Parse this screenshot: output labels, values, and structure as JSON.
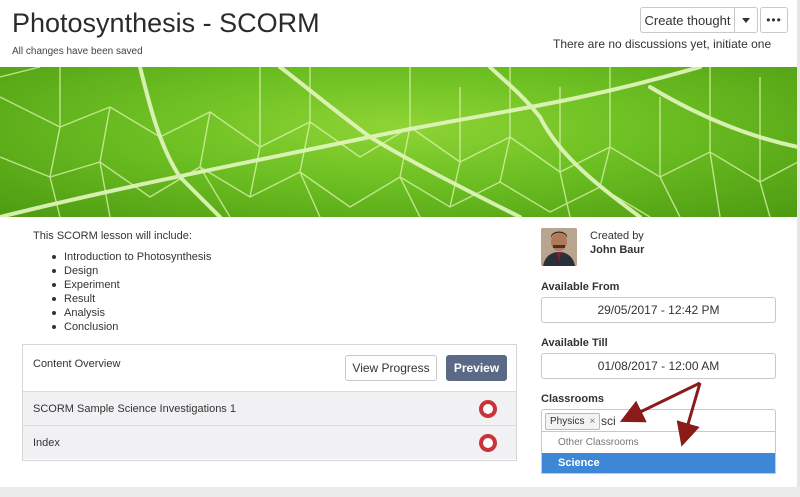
{
  "header": {
    "title": "Photosynthesis - SCORM",
    "save_status": "All changes have been saved",
    "create_thought_label": "Create thought",
    "more_label": "•••",
    "discussion_note": "There are no discussions yet, initiate one"
  },
  "lesson": {
    "intro": "This SCORM lesson will include:",
    "topics": [
      "Introduction to Photosynthesis",
      "Design",
      "Experiment",
      "Result",
      "Analysis",
      "Conclusion"
    ]
  },
  "content_overview": {
    "title": "Content Overview",
    "view_progress_label": "View Progress",
    "preview_label": "Preview",
    "rows": [
      {
        "label": "SCORM Sample Science Investigations 1"
      },
      {
        "label": "Index"
      }
    ]
  },
  "sidebar": {
    "created_by_label": "Created by",
    "creator_name": "John Baur",
    "available_from_label": "Available From",
    "available_from_value": "29/05/2017 - 12:42 PM",
    "available_till_label": "Available Till",
    "available_till_value": "01/08/2017 - 12:00 AM",
    "classrooms_label": "Classrooms",
    "classroom_tags": [
      "Physics"
    ],
    "classroom_tag_remove": "×",
    "classroom_input_value": "sci",
    "dropdown_group": "Other Classrooms",
    "dropdown_option": "Science"
  },
  "colors": {
    "preview_button": "#5a6a86",
    "status_ring": "#c9343a",
    "dropdown_highlight": "#3d87d7",
    "annotation_arrow": "#8b1a1a"
  }
}
